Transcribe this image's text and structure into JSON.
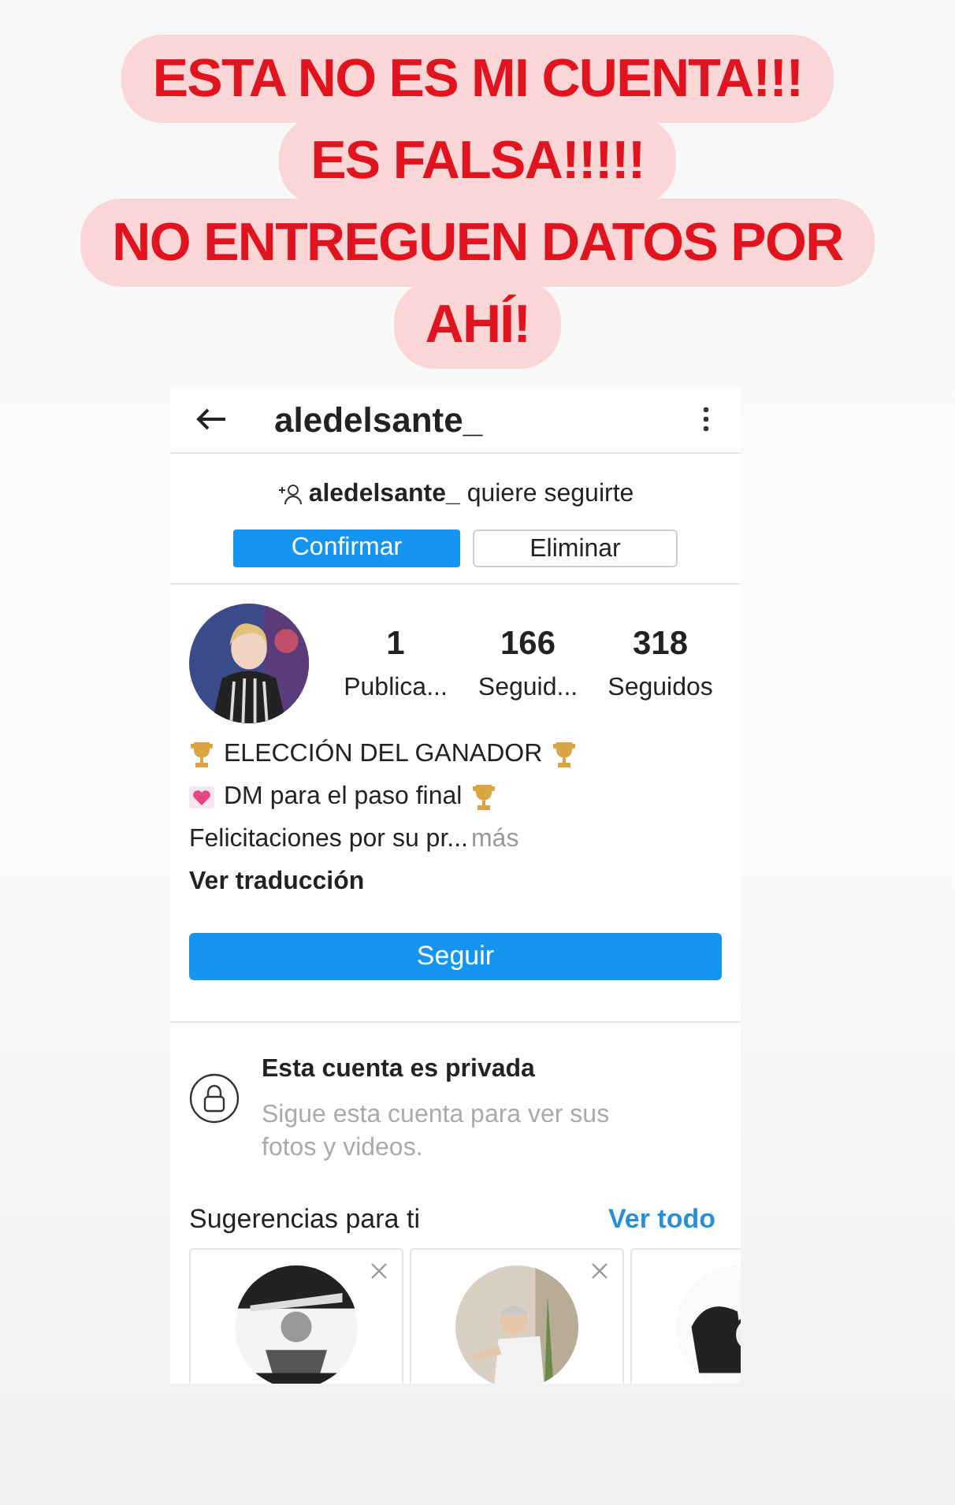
{
  "banner": {
    "lines": [
      "ESTA NO ES MI CUENTA!!!",
      "ES FALSA!!!!!",
      "NO ENTREGUEN DATOS POR",
      "AHÍ!"
    ]
  },
  "header": {
    "username": "aledelsante_"
  },
  "follow_request": {
    "username": "aledelsante_",
    "text": "quiere seguirte",
    "buttons": [
      {
        "label": "Confirmar",
        "kind": "primary"
      },
      {
        "label": "Eliminar",
        "kind": "secondary"
      }
    ]
  },
  "stats": [
    {
      "value": "1",
      "label": "Publica..."
    },
    {
      "value": "166",
      "label": "Seguid..."
    },
    {
      "value": "318",
      "label": "Seguidos"
    }
  ],
  "bio": [
    {
      "text": "ELECCIÓN DEL GANADOR",
      "kind": "trophies"
    },
    {
      "text": "DM para el paso final",
      "kind": "heart_trophy"
    },
    {
      "text": "Felicitaciones por su pr...",
      "more": "más",
      "kind": "plain"
    },
    {
      "text": "Ver traducción",
      "kind": "link"
    }
  ],
  "follow_button": "Seguir",
  "private": {
    "title": "Esta cuenta es privada",
    "text": "Sigue esta cuenta para ver sus fotos y videos."
  },
  "suggestions": {
    "title": "Sugerencias para ti",
    "link": "Ver todo",
    "cards": [
      {
        "kind": "picture",
        "dismissable": true
      },
      {
        "kind": "picture",
        "dismissable": true
      },
      {
        "kind": "picture"
      }
    ]
  }
}
